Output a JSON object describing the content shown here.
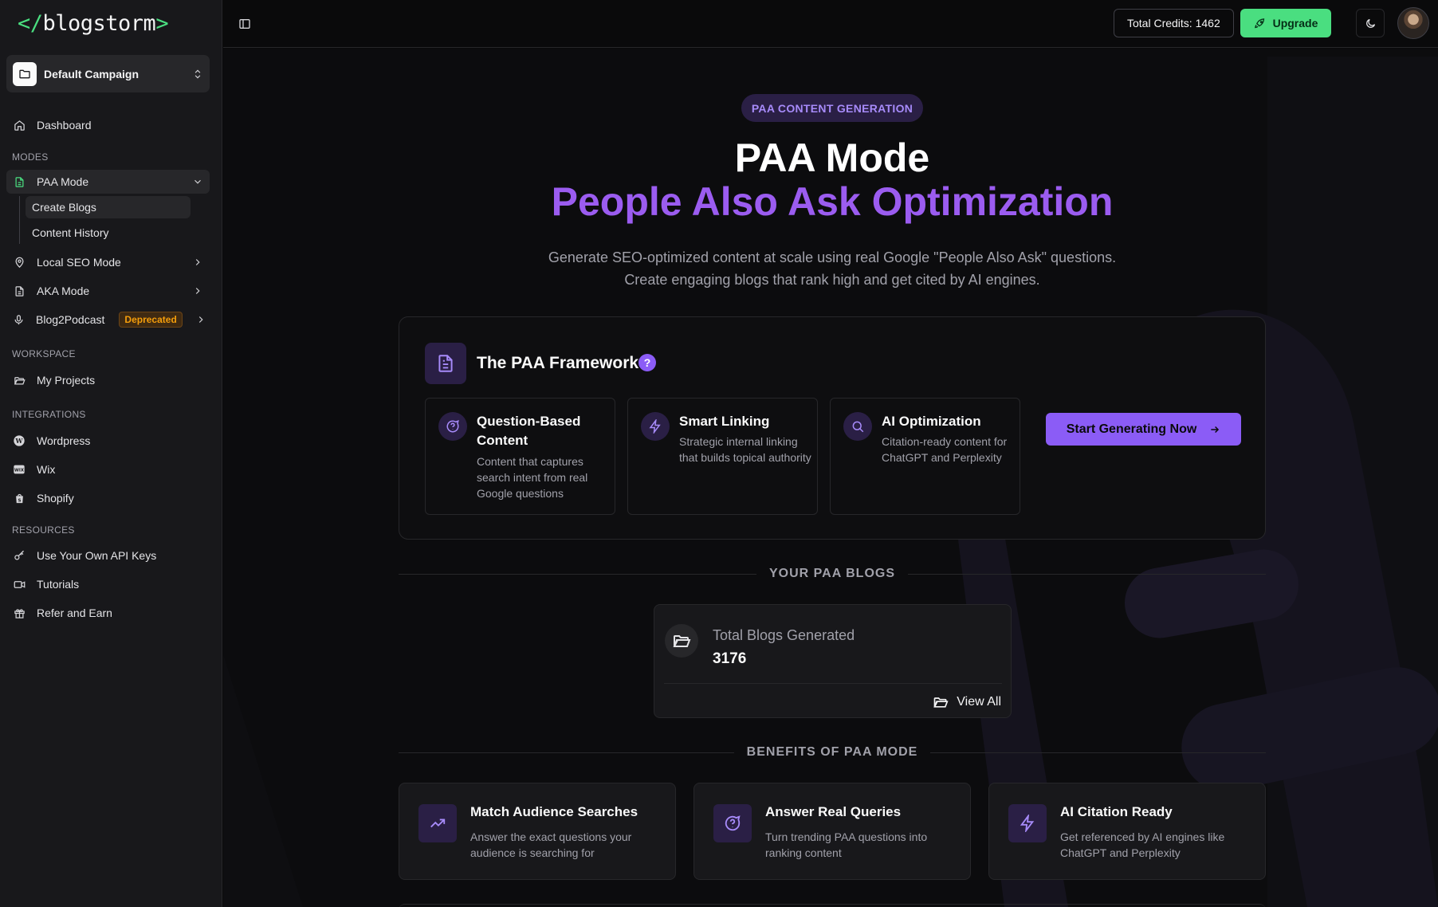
{
  "sidebar": {
    "logo": {
      "open": "</",
      "word": "blogstorm",
      "close": ">"
    },
    "campaign": {
      "name": "Default Campaign"
    },
    "dashboard": "Dashboard",
    "sections": {
      "modes": "MODES",
      "workspace": "WORKSPACE",
      "integrations": "INTEGRATIONS",
      "resources": "RESOURCES"
    },
    "modes": {
      "paa": "PAA Mode",
      "paa_sub": [
        "Create Blogs",
        "Content History"
      ],
      "local_seo": "Local SEO Mode",
      "aka": "AKA Mode",
      "blog2podcast": "Blog2Podcast",
      "deprecated_badge": "Deprecated"
    },
    "workspace": {
      "projects": "My Projects"
    },
    "integrations": [
      "Wordpress",
      "Wix",
      "Shopify"
    ],
    "resources": [
      "Use Your Own API Keys",
      "Tutorials",
      "Refer and Earn"
    ]
  },
  "header": {
    "credits": "Total Credits: 1462",
    "upgrade": "Upgrade"
  },
  "hero": {
    "pill": "PAA CONTENT GENERATION",
    "title": "PAA Mode",
    "subtitle": "People Also Ask Optimization",
    "desc_line1": "Generate SEO-optimized content at scale using real Google \"People Also Ask\" questions.",
    "desc_line2": "Create engaging blogs that rank high and get cited by AI engines."
  },
  "framework": {
    "title": "The PAA Framework",
    "help": "?",
    "cards": [
      {
        "title": "Question-Based Content",
        "desc": "Content that captures search intent from real Google questions",
        "icon": "message-question-icon"
      },
      {
        "title": "Smart Linking",
        "desc": "Strategic internal linking that builds topical authority",
        "icon": "bolt-icon"
      },
      {
        "title": "AI Optimization",
        "desc": "Citation-ready content for ChatGPT and Perplexity",
        "icon": "search-icon"
      }
    ],
    "cta": "Start Generating Now"
  },
  "blogs": {
    "heading": "YOUR PAA BLOGS",
    "total_label": "Total Blogs Generated",
    "total_value": "3176",
    "view_all": "View All"
  },
  "benefits": {
    "heading": "BENEFITS OF PAA MODE",
    "items": [
      {
        "title": "Match Audience Searches",
        "desc": "Answer the exact questions your audience is searching for",
        "icon": "trending-up-icon"
      },
      {
        "title": "Answer Real Queries",
        "desc": "Turn trending PAA questions into ranking content",
        "icon": "message-question-icon"
      },
      {
        "title": "AI Citation Ready",
        "desc": "Get referenced by AI engines like ChatGPT and Perplexity",
        "icon": "bolt-icon"
      }
    ]
  },
  "colors": {
    "accent": "#8b5cf6",
    "brand_green": "#4ade80",
    "background": "#0a0a0b"
  }
}
